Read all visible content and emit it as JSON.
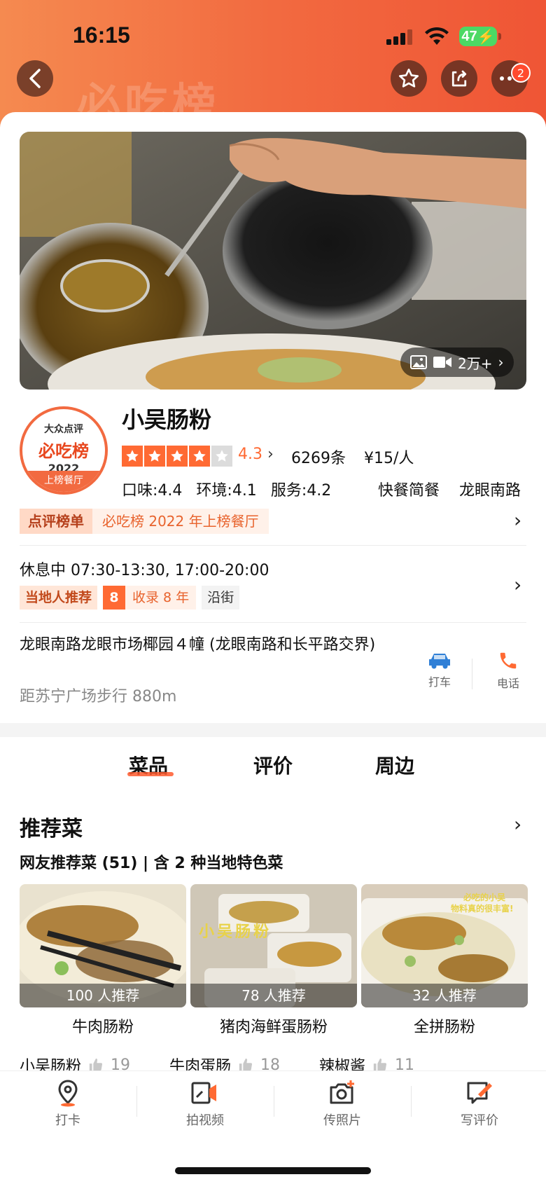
{
  "status_bar": {
    "time": "16:15",
    "battery": "47"
  },
  "header": {
    "watermark": "必吃榜",
    "notification_count": "2"
  },
  "hero": {
    "media_count": "2万+"
  },
  "award_badge": {
    "brand": "大众点评",
    "title": "必吃榜",
    "year": "2022",
    "caption": "上榜餐厅"
  },
  "shop": {
    "name": "小吴肠粉",
    "rating": "4.3",
    "rating_value": 4.3,
    "review_count": "6269条",
    "price_per_person": "¥15/人",
    "scores": {
      "taste": "口味:4.4",
      "environment": "环境:4.1",
      "service": "服务:4.2"
    },
    "category": "快餐简餐",
    "area": "龙眼南路"
  },
  "ranking": {
    "tag": "点评榜单",
    "text": "必吃榜 2022 年上榜餐厅"
  },
  "hours": {
    "text": "休息中 07:30-13:30, 17:00-20:00"
  },
  "tags": {
    "local": "当地人推荐",
    "years_number": "8",
    "years_text": "收录 8 年",
    "street": "沿街"
  },
  "location": {
    "address": "龙眼南路龙眼市场椰园４幢 (龙眼南路和长平路交界)",
    "distance": "距苏宁广场步行 880m",
    "taxi_label": "打车",
    "phone_label": "电话"
  },
  "tabs": [
    "菜品",
    "评价",
    "周边"
  ],
  "dishes_section": {
    "title": "推荐菜",
    "subtitle": "网友推荐菜 (51) | 含 2 种当地特色菜",
    "items": [
      {
        "name": "牛肉肠粉",
        "count": "100 人推荐"
      },
      {
        "name": "猪肉海鲜蛋肠粉",
        "count": "78 人推荐"
      },
      {
        "name": "全拼肠粉",
        "count": "32 人推荐"
      }
    ],
    "overlay_texts": [
      "小吴肠粉",
      "必吃的小吴",
      "物料真的很丰富!"
    ],
    "more": [
      {
        "name": "小吴肠粉",
        "likes": "19"
      },
      {
        "name": "牛肉蛋肠",
        "likes": "18"
      },
      {
        "name": "辣椒酱",
        "likes": "11"
      }
    ]
  },
  "bottom_bar": [
    "打卡",
    "拍视频",
    "传照片",
    "写评价"
  ],
  "colors": {
    "accent": "#ff6a33",
    "brand_gradient_start": "#f58a50",
    "brand_gradient_end": "#ef5535"
  }
}
